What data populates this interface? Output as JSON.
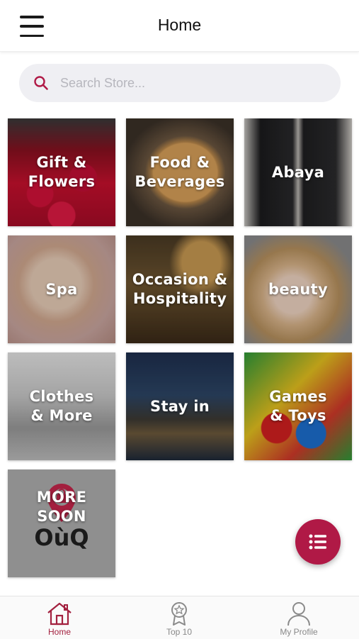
{
  "header": {
    "title": "Home"
  },
  "search": {
    "placeholder": "Search Store..."
  },
  "categories": [
    {
      "label": "Gift &\nFlowers"
    },
    {
      "label": "Food &\nBeverages"
    },
    {
      "label": "Abaya"
    },
    {
      "label": "Spa"
    },
    {
      "label": "Occasion &\nHospitality"
    },
    {
      "label": "beauty"
    },
    {
      "label": "Clothes\n& More"
    },
    {
      "label": "Stay in"
    },
    {
      "label": "Games\n& Toys"
    },
    {
      "label": "MORE\nSOON",
      "logo_text": "OùQ"
    }
  ],
  "tabs": [
    {
      "label": "Home",
      "icon": "home-icon",
      "active": true
    },
    {
      "label": "Top 10",
      "icon": "award-icon",
      "active": false
    },
    {
      "label": "My Profile",
      "icon": "profile-icon",
      "active": false
    }
  ],
  "colors": {
    "accent": "#b01946",
    "active_tab": "#a3213f"
  }
}
